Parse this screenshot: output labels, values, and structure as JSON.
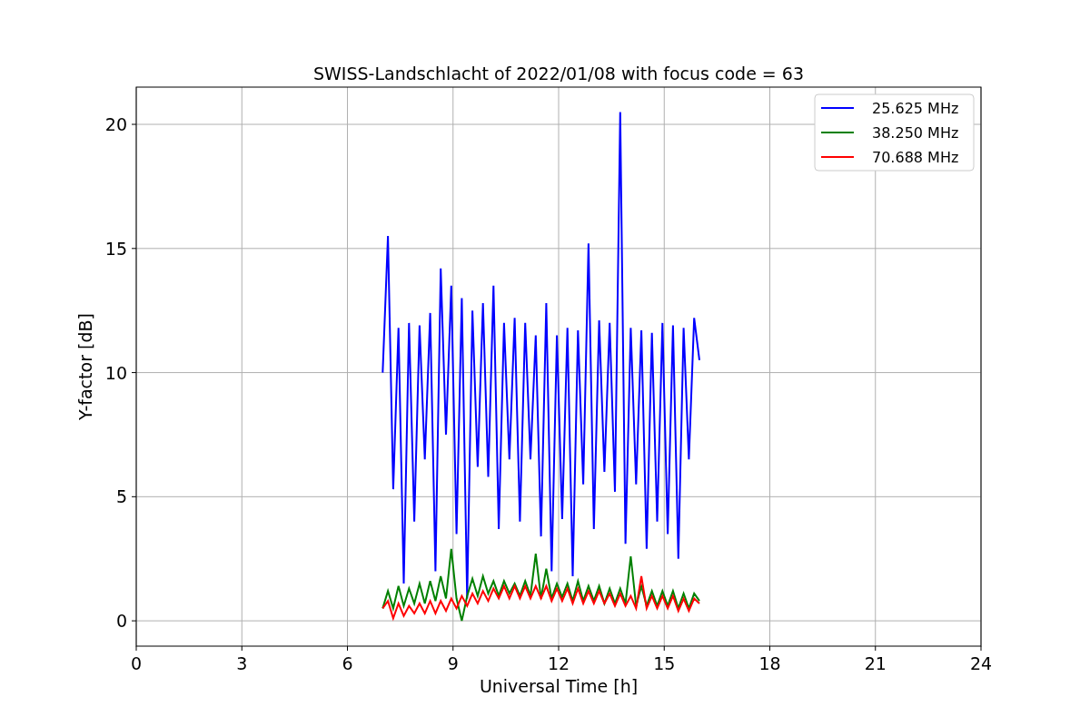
{
  "chart_data": {
    "type": "line",
    "title": "SWISS-Landschlacht of 2022/01/08 with focus code = 63",
    "xlabel": "Universal Time [h]",
    "ylabel": "Y-factor [dB]",
    "x": [
      7.0,
      7.15,
      7.3,
      7.45,
      7.6,
      7.75,
      7.9,
      8.05,
      8.2,
      8.35,
      8.5,
      8.65,
      8.8,
      8.95,
      9.1,
      9.25,
      9.4,
      9.55,
      9.7,
      9.85,
      10.0,
      10.15,
      10.3,
      10.45,
      10.6,
      10.75,
      10.9,
      11.05,
      11.2,
      11.35,
      11.5,
      11.65,
      11.8,
      11.95,
      12.1,
      12.25,
      12.4,
      12.55,
      12.7,
      12.85,
      13.0,
      13.15,
      13.3,
      13.45,
      13.6,
      13.75,
      13.9,
      14.05,
      14.2,
      14.35,
      14.5,
      14.65,
      14.8,
      14.95,
      15.1,
      15.25,
      15.4,
      15.55,
      15.7,
      15.85,
      16.0
    ],
    "series": [
      {
        "name": "25.625 MHz",
        "color": "#0000ff",
        "values": [
          10.0,
          15.5,
          5.3,
          11.8,
          1.5,
          12.0,
          4.0,
          11.9,
          6.5,
          12.4,
          2.0,
          14.2,
          7.5,
          13.5,
          3.5,
          13.0,
          0.9,
          12.5,
          6.2,
          12.8,
          5.8,
          13.5,
          3.7,
          12.0,
          6.5,
          12.2,
          4.0,
          12.0,
          6.5,
          11.5,
          3.4,
          12.8,
          2.0,
          11.5,
          4.1,
          11.8,
          1.8,
          11.7,
          5.5,
          15.2,
          3.7,
          12.1,
          6.0,
          12.0,
          5.2,
          20.5,
          3.1,
          11.8,
          5.5,
          11.7,
          2.9,
          11.6,
          4.0,
          12.0,
          3.5,
          11.9,
          2.5,
          11.8,
          6.5,
          12.2,
          10.5
        ]
      },
      {
        "name": "38.250 MHz",
        "color": "#008000",
        "values": [
          0.5,
          1.2,
          0.5,
          1.4,
          0.6,
          1.3,
          0.7,
          1.5,
          0.7,
          1.6,
          0.8,
          1.8,
          0.9,
          2.9,
          0.9,
          0.0,
          1.0,
          1.7,
          1.0,
          1.8,
          1.1,
          1.6,
          1.0,
          1.6,
          1.1,
          1.5,
          1.0,
          1.6,
          1.0,
          2.7,
          0.9,
          2.1,
          0.9,
          1.5,
          0.95,
          1.5,
          0.8,
          1.6,
          0.8,
          1.4,
          0.8,
          1.4,
          0.7,
          1.3,
          0.7,
          1.3,
          0.7,
          2.6,
          0.6,
          1.4,
          0.6,
          1.2,
          0.6,
          1.2,
          0.6,
          1.2,
          0.5,
          1.1,
          0.5,
          1.1,
          0.8
        ]
      },
      {
        "name": "70.688 MHz",
        "color": "#ff0000",
        "values": [
          0.5,
          0.8,
          0.1,
          0.7,
          0.2,
          0.6,
          0.3,
          0.7,
          0.3,
          0.8,
          0.3,
          0.8,
          0.4,
          0.9,
          0.5,
          1.0,
          0.6,
          1.1,
          0.7,
          1.2,
          0.8,
          1.3,
          0.9,
          1.4,
          0.9,
          1.4,
          0.9,
          1.4,
          0.9,
          1.4,
          0.9,
          1.4,
          0.8,
          1.3,
          0.8,
          1.3,
          0.7,
          1.3,
          0.7,
          1.2,
          0.7,
          1.2,
          0.7,
          1.1,
          0.6,
          1.1,
          0.6,
          1.0,
          0.5,
          1.8,
          0.5,
          1.0,
          0.5,
          1.0,
          0.5,
          1.0,
          0.4,
          0.9,
          0.4,
          0.9,
          0.7
        ]
      }
    ],
    "xlim": [
      0,
      24
    ],
    "ylim": [
      -1.02,
      21.5
    ],
    "xticks": [
      0,
      3,
      6,
      9,
      12,
      15,
      18,
      21,
      24
    ],
    "yticks": [
      0,
      5,
      10,
      15,
      20
    ],
    "grid": true,
    "legend": true
  }
}
